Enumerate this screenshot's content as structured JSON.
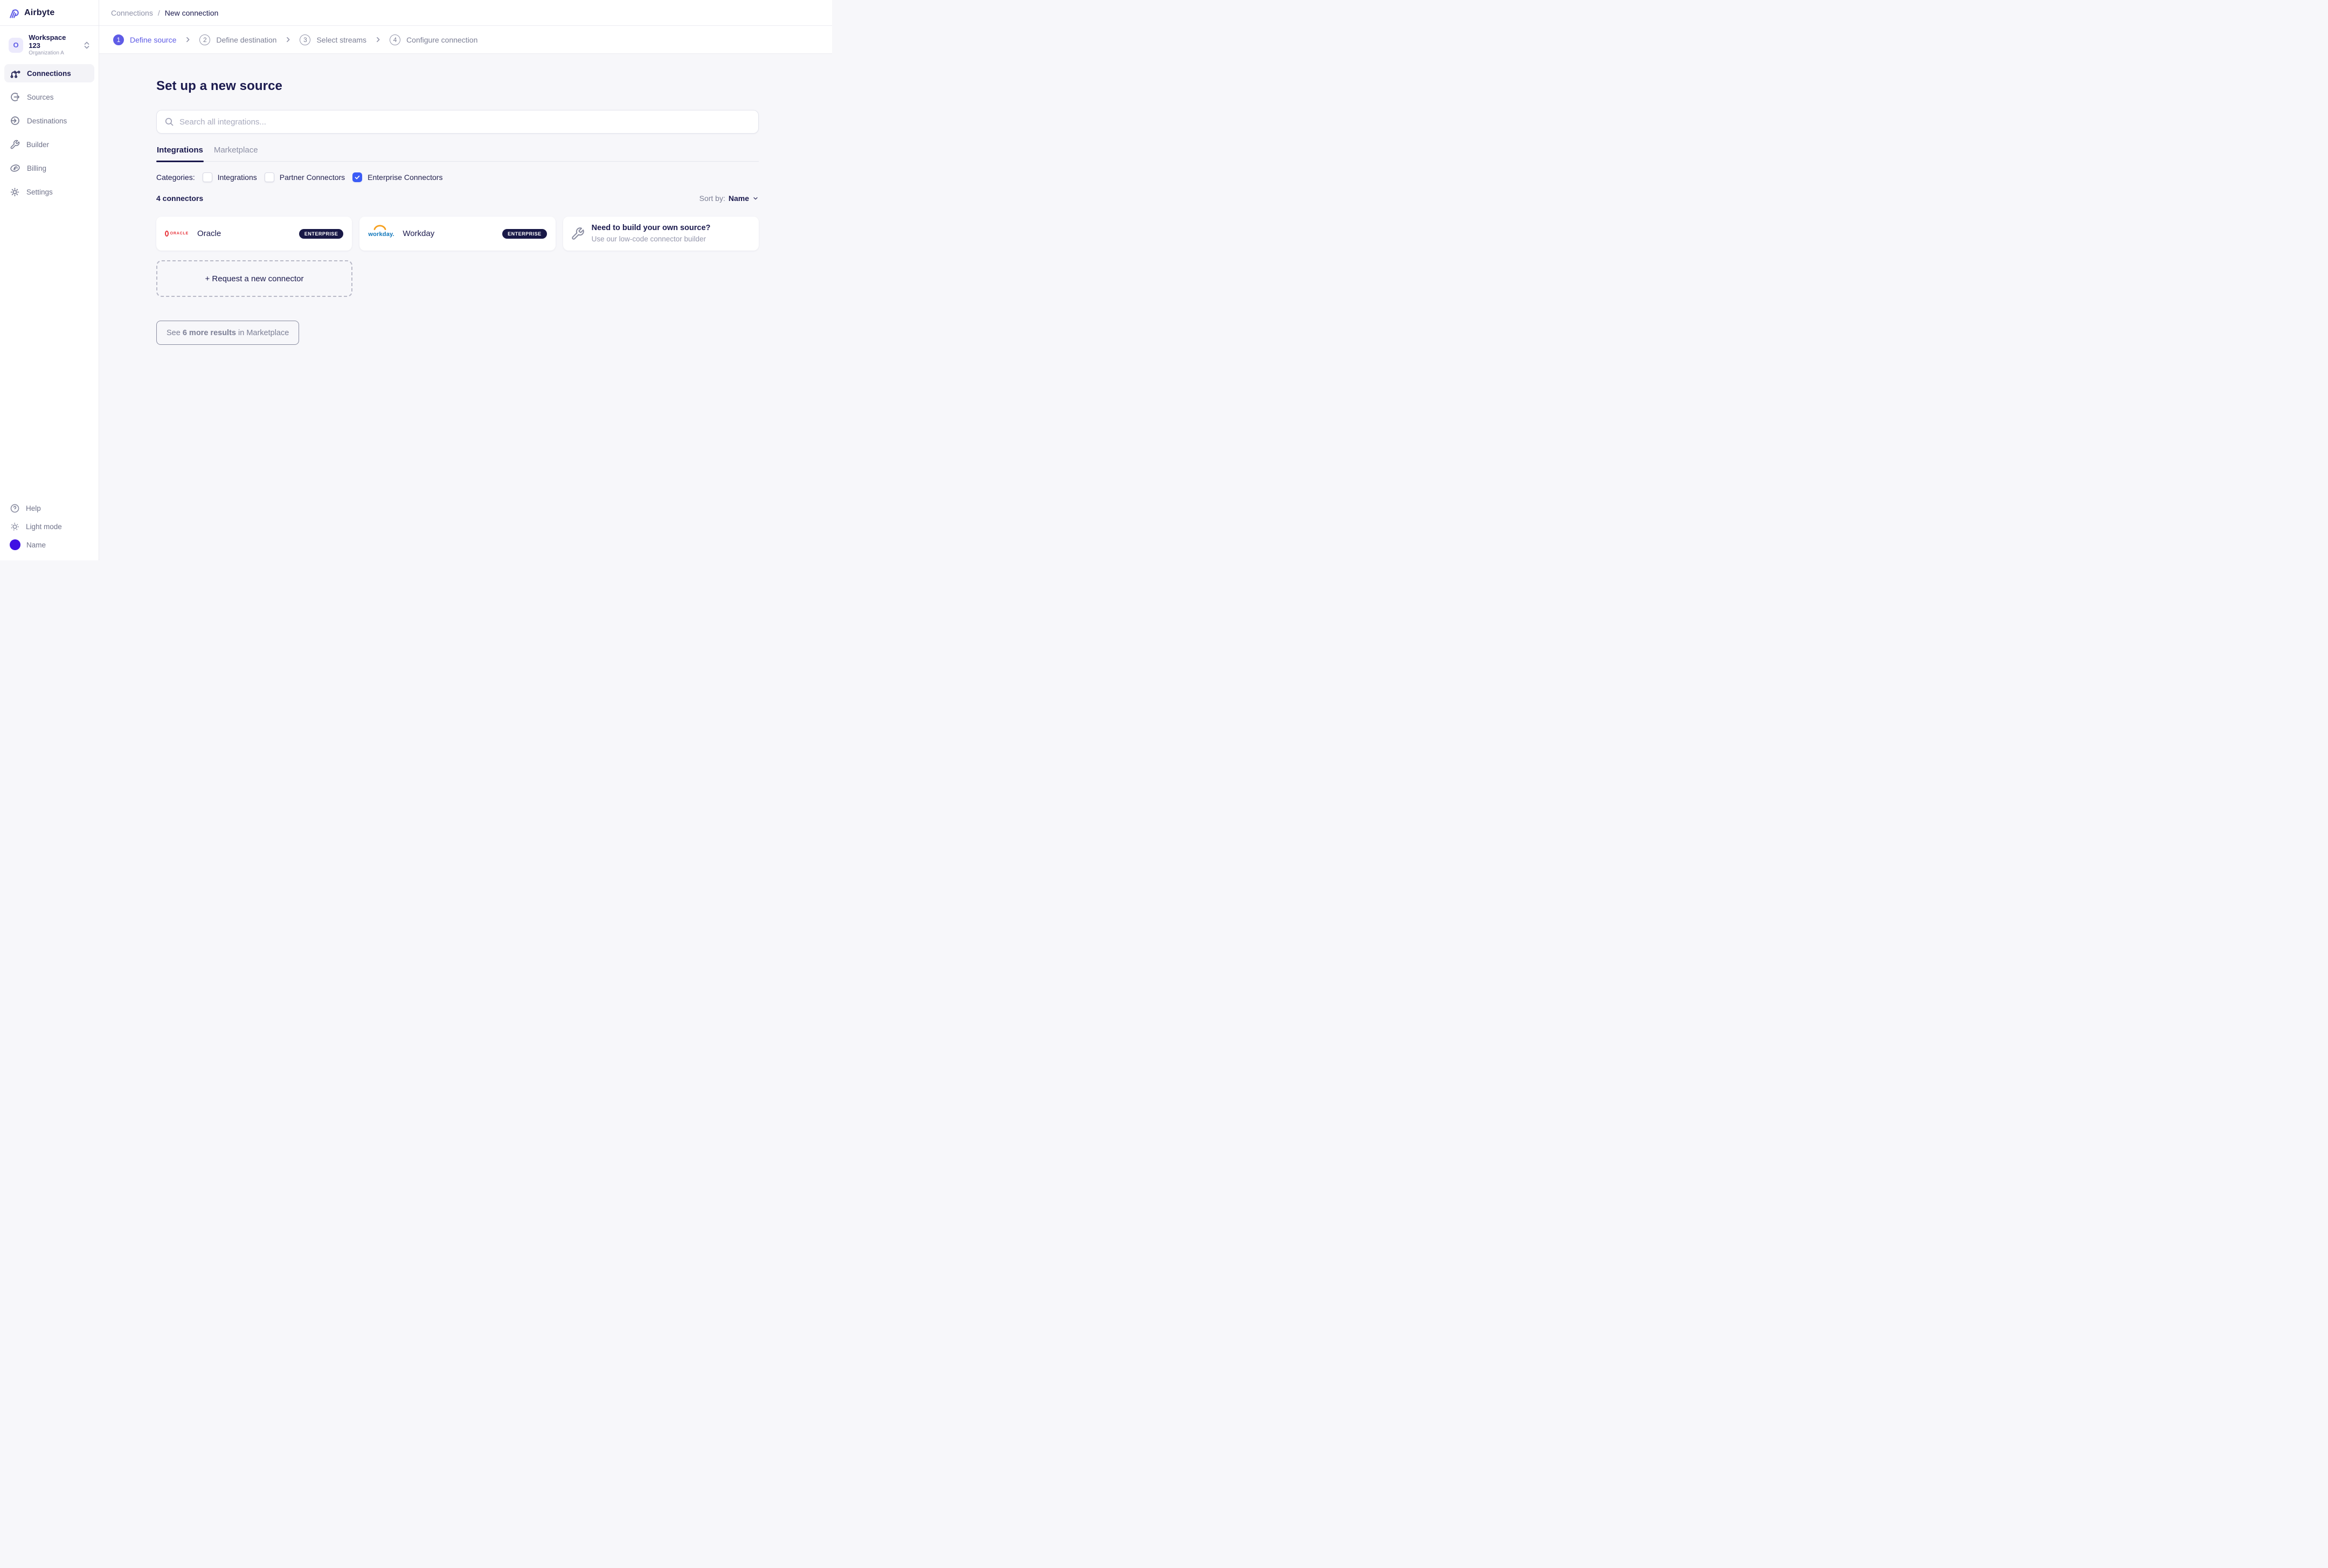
{
  "brand": {
    "name": "Airbyte"
  },
  "workspace": {
    "initial": "O",
    "name": "Workspace 123",
    "org": "Organization A"
  },
  "sidebar": {
    "items": [
      {
        "label": "Connections",
        "active": true
      },
      {
        "label": "Sources",
        "active": false
      },
      {
        "label": "Destinations",
        "active": false
      },
      {
        "label": "Builder",
        "active": false
      },
      {
        "label": "Billing",
        "active": false
      },
      {
        "label": "Settings",
        "active": false
      }
    ],
    "footer": {
      "help": "Help",
      "theme": "Light mode",
      "user": "Name"
    }
  },
  "breadcrumb": {
    "parent": "Connections",
    "separator": "/",
    "current": "New connection"
  },
  "stepper": {
    "steps": [
      {
        "num": "1",
        "label": "Define source",
        "active": true
      },
      {
        "num": "2",
        "label": "Define destination",
        "active": false
      },
      {
        "num": "3",
        "label": "Select streams",
        "active": false
      },
      {
        "num": "4",
        "label": "Configure connection",
        "active": false
      }
    ]
  },
  "main": {
    "title": "Set up a new source",
    "search_placeholder": "Search all integrations...",
    "tabs": [
      {
        "label": "Integrations",
        "active": true
      },
      {
        "label": "Marketplace",
        "active": false
      }
    ],
    "categories": {
      "label": "Categories:",
      "options": [
        {
          "label": "Integrations",
          "checked": false
        },
        {
          "label": "Partner Connectors",
          "checked": false
        },
        {
          "label": "Enterprise Connectors",
          "checked": true
        }
      ]
    },
    "results_count": "4 connectors",
    "sort": {
      "label": "Sort by:",
      "value": "Name"
    },
    "connectors": [
      {
        "name": "Oracle",
        "badge": "ENTERPRISE",
        "logo_text": "ORACLE"
      },
      {
        "name": "Workday",
        "badge": "ENTERPRISE",
        "logo_text": "workday."
      }
    ],
    "builder_card": {
      "title": "Need to build your own source?",
      "subtitle": "Use our low-code connector builder"
    },
    "request_button": "+ Request a new connector",
    "see_more": {
      "prefix": "See ",
      "bold": "6 more results",
      "suffix": " in Marketplace"
    }
  },
  "colors": {
    "navy": "#1a194d",
    "indigo": "#5f5ce6",
    "checkbox_blue": "#3b5cf6",
    "avatar_purple": "#3f0fe3",
    "badge_bg": "#191947",
    "oracle_red": "#e8363d",
    "workday_blue": "#0e76bb",
    "workday_orange": "#f6a01e"
  }
}
